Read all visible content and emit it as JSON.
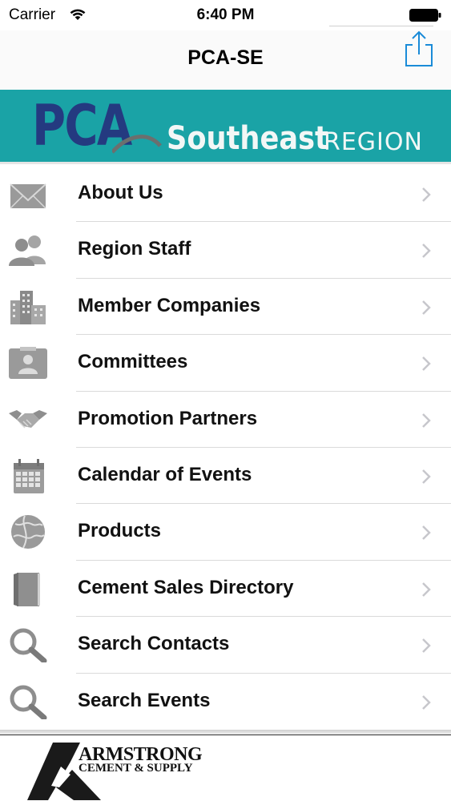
{
  "status_bar": {
    "carrier": "Carrier",
    "time": "6:40 PM"
  },
  "nav": {
    "title": "PCA-SE",
    "share_icon": "share-icon"
  },
  "banner": {
    "logo_text": "PCA",
    "region_name": "Southeast",
    "region_word": "REGION",
    "background": "#1aa3a6"
  },
  "menu": {
    "items": [
      {
        "label": "About Us",
        "icon": "envelope-icon"
      },
      {
        "label": "Region Staff",
        "icon": "people-icon"
      },
      {
        "label": "Member Companies",
        "icon": "buildings-icon"
      },
      {
        "label": "Committees",
        "icon": "contact-card-icon"
      },
      {
        "label": "Promotion Partners",
        "icon": "handshake-icon"
      },
      {
        "label": "Calendar of Events",
        "icon": "calendar-icon"
      },
      {
        "label": "Products",
        "icon": "globe-icon"
      },
      {
        "label": "Cement Sales Directory",
        "icon": "book-icon"
      },
      {
        "label": "Search Contacts",
        "icon": "search-icon"
      },
      {
        "label": "Search Events",
        "icon": "search-icon"
      }
    ]
  },
  "footer": {
    "company_name": "ARMSTRONG",
    "company_sub": "CEMENT & SUPPLY"
  },
  "colors": {
    "accent": "#1a8bd8",
    "banner_teal": "#1aa3a6",
    "pca_navy": "#243a80"
  }
}
